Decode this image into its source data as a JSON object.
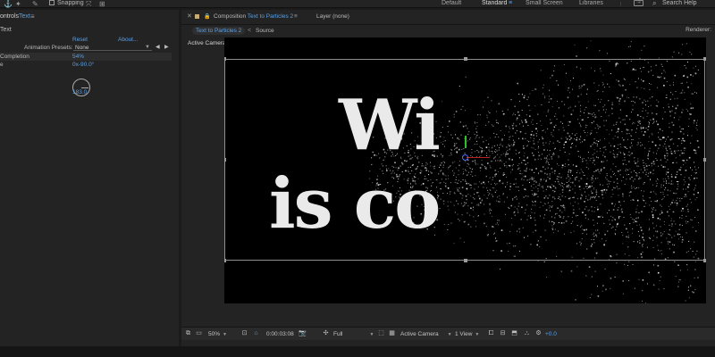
{
  "toolbar": {
    "snapping_label": "Snapping",
    "workspaces": [
      "Default",
      "Standard",
      "Small Screen",
      "Libraries"
    ],
    "active_workspace": "Standard",
    "search_label": "Search Help"
  },
  "effect_controls": {
    "tab_prefix": "ontrols",
    "tab_target": "Text",
    "layer_name": "Text",
    "reset_label": "Reset",
    "about_label": "About...",
    "presets_label": "Animation Presets:",
    "presets_value": "None",
    "completion_label": "Completion",
    "completion_value": "54%",
    "rotation_prefix": "e",
    "rotation_value": "0x-90.0°",
    "random_value": "183.0"
  },
  "composition": {
    "tab_label": "Composition",
    "comp_name": "Text to Particles 2",
    "layer_tab": "Layer (none)",
    "crumb_active": "Text to Particles 2",
    "crumb_next": "Source",
    "renderer_label": "Renderer:",
    "viewer_label": "Active Camera",
    "line1": "Wi",
    "line2": "is co"
  },
  "viewer_controls": {
    "zoom": "50%",
    "timecode": "0:00:03:08",
    "resolution": "Full",
    "view": "Active Camera",
    "layout": "1 View",
    "exposure": "+0.0"
  },
  "colors": {
    "accent": "#5aa0e6",
    "panel": "#232323",
    "viewer_bg": "#000000",
    "axis_y": "#2fbf2f",
    "axis_x": "#bb2222"
  }
}
